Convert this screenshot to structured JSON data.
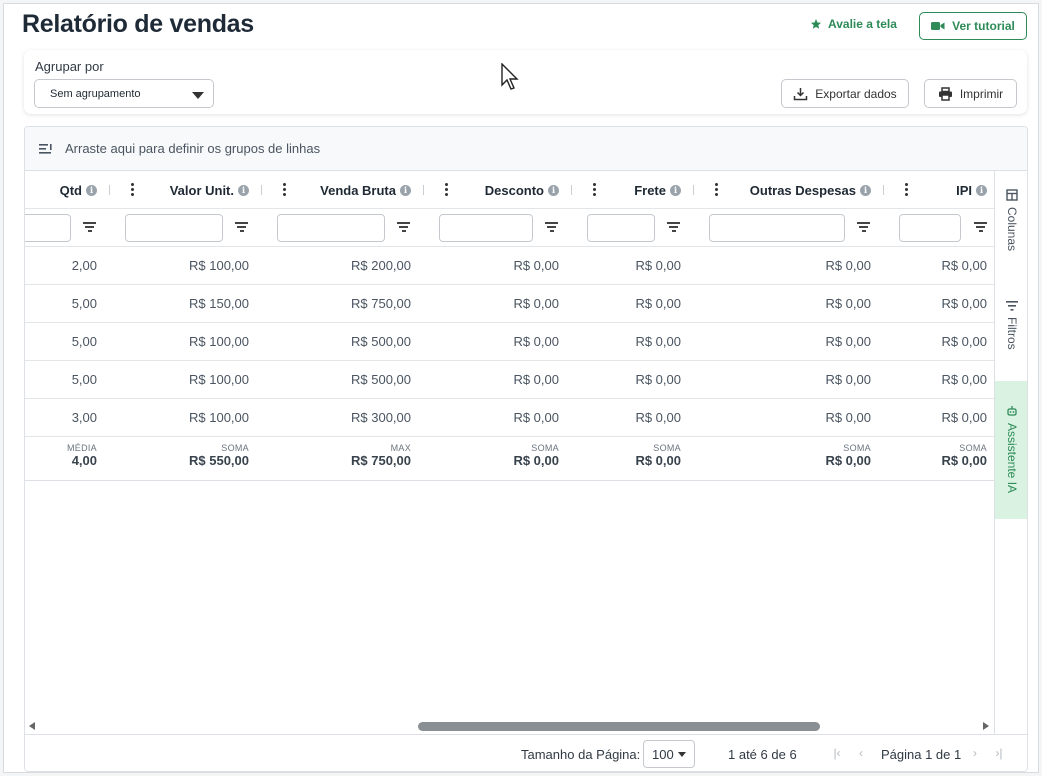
{
  "header": {
    "title": "Relatório de vendas",
    "rate_label": "Avalie a tela",
    "tutorial_label": "Ver tutorial"
  },
  "toolbar": {
    "group_label": "Agrupar por",
    "group_value": "Sem agrupamento",
    "export_label": "Exportar dados",
    "print_label": "Imprimir"
  },
  "grid": {
    "group_panel_text": "Arraste aqui para definir os grupos de linhas",
    "columns": [
      "Qtd",
      "Valor Unit.",
      "Venda Bruta",
      "Desconto",
      "Frete",
      "Outras Despesas",
      "IPI"
    ],
    "rows": [
      [
        "2,00",
        "R$ 100,00",
        "R$ 200,00",
        "R$ 0,00",
        "R$ 0,00",
        "R$ 0,00",
        "R$ 0,00"
      ],
      [
        "5,00",
        "R$ 150,00",
        "R$ 750,00",
        "R$ 0,00",
        "R$ 0,00",
        "R$ 0,00",
        "R$ 0,00"
      ],
      [
        "5,00",
        "R$ 100,00",
        "R$ 500,00",
        "R$ 0,00",
        "R$ 0,00",
        "R$ 0,00",
        "R$ 0,00"
      ],
      [
        "5,00",
        "R$ 100,00",
        "R$ 500,00",
        "R$ 0,00",
        "R$ 0,00",
        "R$ 0,00",
        "R$ 0,00"
      ],
      [
        "3,00",
        "R$ 100,00",
        "R$ 300,00",
        "R$ 0,00",
        "R$ 0,00",
        "R$ 0,00",
        "R$ 0,00"
      ]
    ],
    "footer": [
      {
        "agg": "MÉDIA",
        "value": "4,00"
      },
      {
        "agg": "SOMA",
        "value": "R$ 550,00"
      },
      {
        "agg": "MAX",
        "value": "R$ 750,00"
      },
      {
        "agg": "SOMA",
        "value": "R$ 0,00"
      },
      {
        "agg": "SOMA",
        "value": "R$ 0,00"
      },
      {
        "agg": "SOMA",
        "value": "R$ 0,00"
      },
      {
        "agg": "SOMA",
        "value": "R$ 0,00"
      }
    ],
    "side_tabs": {
      "columns": "Colunas",
      "filters": "Filtros",
      "ai": "Assistente IA"
    }
  },
  "pager": {
    "size_label": "Tamanho da Página:",
    "size_value": "100",
    "range_text": "1 até 6 de 6",
    "page_text": "Página 1 de 1"
  },
  "colors": {
    "accent": "#2e8b57",
    "ai_tab_bg": "#d9f2e2"
  }
}
